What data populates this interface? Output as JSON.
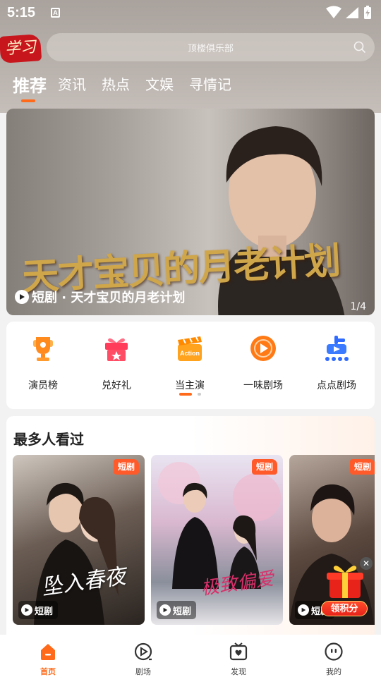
{
  "status_bar": {
    "time": "5:15",
    "notification_glyph": "A"
  },
  "header": {
    "logo_text": "学习",
    "search": {
      "placeholder": "顶楼俱乐部"
    }
  },
  "tabs": [
    {
      "label": "推荐",
      "active": true
    },
    {
      "label": "资讯",
      "active": false
    },
    {
      "label": "热点",
      "active": false
    },
    {
      "label": "文娱",
      "active": false
    },
    {
      "label": "寻情记",
      "active": false
    }
  ],
  "banner": {
    "poster_title": "天才宝贝的月老计划",
    "caption": "短剧 · 天才宝贝的月老计划",
    "counter": "1/4"
  },
  "shortcuts": [
    {
      "label": "演员榜",
      "icon": "trophy-icon"
    },
    {
      "label": "兑好礼",
      "icon": "gift-icon"
    },
    {
      "label": "当主演",
      "icon": "clapperboard-icon"
    },
    {
      "label": "一味剧场",
      "icon": "play-circle-icon"
    },
    {
      "label": "点点剧场",
      "icon": "diandian-icon"
    }
  ],
  "section": {
    "title": "最多人看过",
    "cards": [
      {
        "badge": "短剧",
        "tag": "短剧",
        "script": "坠入春夜"
      },
      {
        "badge": "短剧",
        "tag": "短剧",
        "script": "极致偏爱"
      },
      {
        "badge": "短剧",
        "tag": "短剧",
        "script": ""
      }
    ]
  },
  "promo": {
    "label": "领积分"
  },
  "tabbar": [
    {
      "label": "首页",
      "icon": "home-icon",
      "active": true
    },
    {
      "label": "剧场",
      "icon": "theater-icon",
      "active": false
    },
    {
      "label": "发现",
      "icon": "discover-icon",
      "active": false
    },
    {
      "label": "我的",
      "icon": "profile-icon",
      "active": false
    }
  ],
  "colors": {
    "accent": "#ff6a1a",
    "badge": "#ff5a2a",
    "logo_red": "#c8161d"
  }
}
